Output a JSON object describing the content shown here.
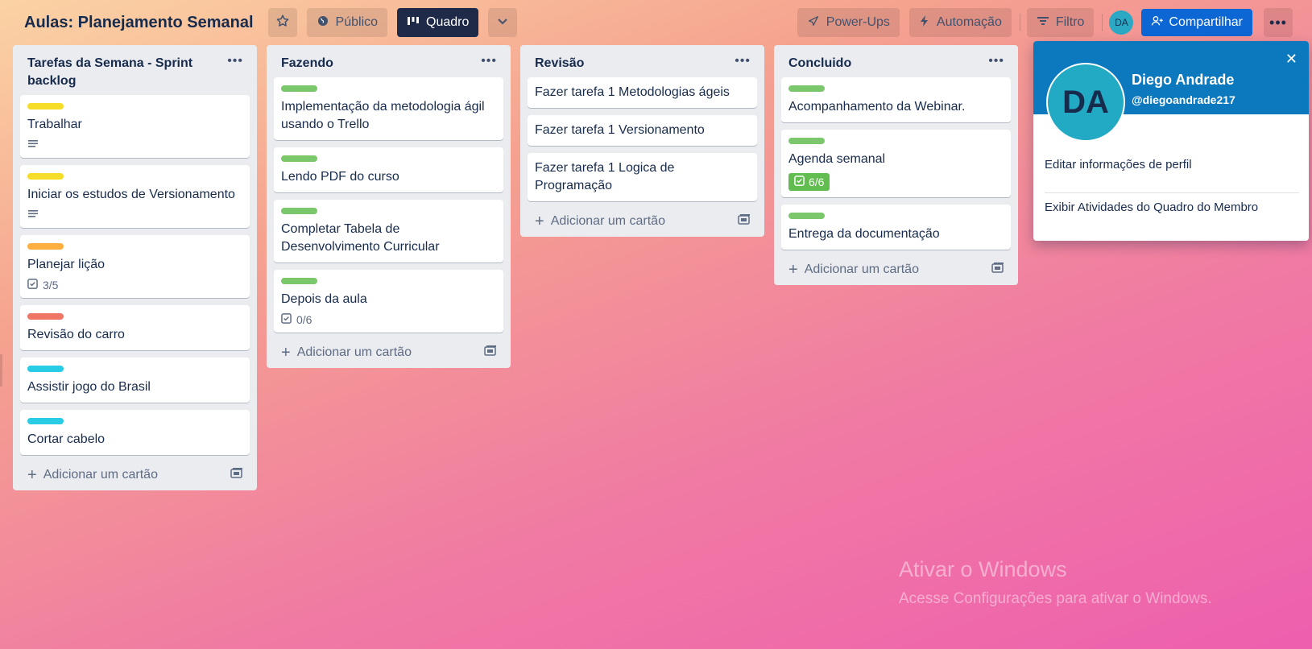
{
  "header": {
    "board_title": "Aulas: Planejamento Semanal",
    "visibility_label": "Público",
    "view_label": "Quadro",
    "powerups_label": "Power-Ups",
    "automation_label": "Automação",
    "filter_label": "Filtro",
    "avatar_initials": "DA",
    "share_label": "Compartilhar"
  },
  "lists": [
    {
      "title": "Tarefas da Semana - Sprint backlog",
      "cards": [
        {
          "title": "Trabalhar",
          "label_color": "#f5dd29",
          "description_icon": true
        },
        {
          "title": "Iniciar os estudos de Versionamento",
          "label_color": "#f5dd29",
          "description_icon": true
        },
        {
          "title": "Planejar lição",
          "label_color": "#ffaf3f",
          "checklist": "3/5"
        },
        {
          "title": "Revisão do carro",
          "label_color": "#ef7564"
        },
        {
          "title": "Assistir jogo do Brasil",
          "label_color": "#29cce5"
        },
        {
          "title": "Cortar cabelo",
          "label_color": "#29cce5"
        }
      ],
      "add_label": "Adicionar um cartão"
    },
    {
      "title": "Fazendo",
      "cards": [
        {
          "title": "Implementação da metodologia ágil usando o Trello",
          "label_color": "#7bc86c"
        },
        {
          "title": "Lendo PDF do curso",
          "label_color": "#7bc86c"
        },
        {
          "title": "Completar Tabela de Desenvolvimento Curricular",
          "label_color": "#7bc86c"
        },
        {
          "title": "Depois da aula",
          "label_color": "#7bc86c",
          "checklist": "0/6"
        }
      ],
      "add_label": "Adicionar um cartão"
    },
    {
      "title": "Revisão",
      "cards": [
        {
          "title": "Fazer tarefa 1 Metodologias ágeis"
        },
        {
          "title": "Fazer tarefa 1 Versionamento"
        },
        {
          "title": "Fazer tarefa 1 Logica de Programação"
        }
      ],
      "add_label": "Adicionar um cartão"
    },
    {
      "title": "Concluido",
      "cards": [
        {
          "title": "Acompanhamento da Webinar.",
          "label_color": "#7bc86c"
        },
        {
          "title": "Agenda semanal",
          "label_color": "#7bc86c",
          "checklist_done": "6/6"
        },
        {
          "title": "Entrega da documentação",
          "label_color": "#7bc86c"
        }
      ],
      "add_label": "Adicionar um cartão"
    }
  ],
  "profile_popover": {
    "initials": "DA",
    "name": "Diego Andrade",
    "handle": "@diegoandrade217",
    "edit_profile": "Editar informações de perfil",
    "view_activity": "Exibir Atividades do Quadro do Membro"
  },
  "watermark": {
    "line1": "Ativar o Windows",
    "line2": "Acesse Configurações para ativar o Windows."
  },
  "colors": {
    "accent": "#0c66d4",
    "popover_header": "#0c79bf",
    "checklist_done": "#61bd4f"
  }
}
